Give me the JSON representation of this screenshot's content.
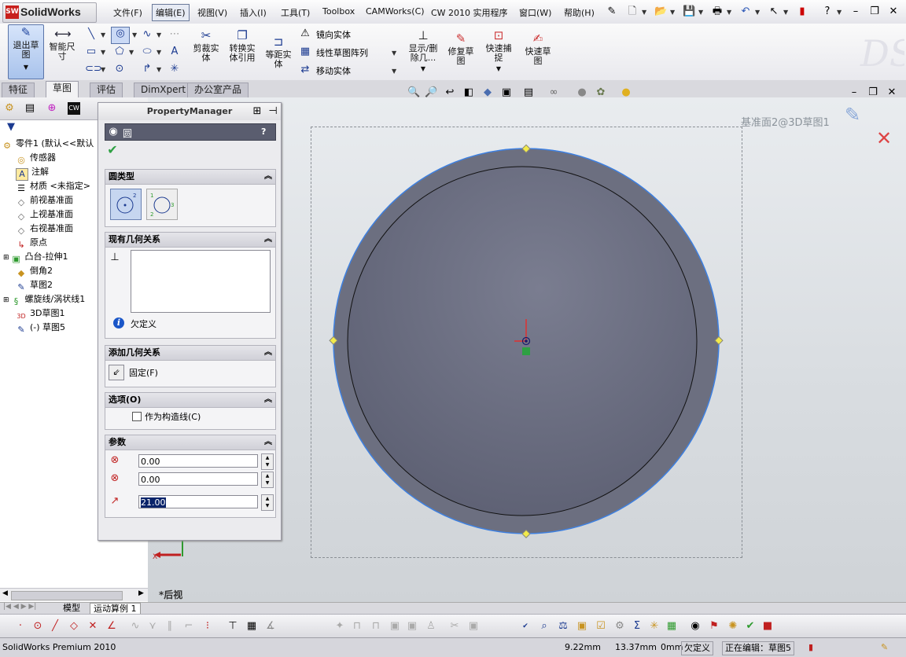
{
  "app": {
    "name": "SolidWorks",
    "logo_badge": "SW"
  },
  "menu": [
    "文件(F)",
    "编辑(E)",
    "视图(V)",
    "插入(I)",
    "工具(T)",
    "Toolbox",
    "CAMWorks(C)",
    "CW 2010 实用程序",
    "窗口(W)",
    "帮助(H)"
  ],
  "menu_active": "编辑(E)",
  "command_manager": {
    "exit_sketch": "退出草\n图",
    "smart_dimension": "智能尺\n寸",
    "trim": "剪裁实\n体",
    "convert": "转换实\n体引用",
    "offset": "等距实\n体",
    "mirror": "镜向实体",
    "linear_pattern": "线性草图阵列",
    "move": "移动实体",
    "show_delete": "显示/删\n除几...",
    "repair": "修复草\n图",
    "quick_snaps": "快速捕\n捉",
    "rapid_sketch": "快速草\n图"
  },
  "tabs": [
    "特征",
    "草图",
    "评估",
    "DimXpert",
    "办公室产品"
  ],
  "active_tab": "草图",
  "tree": [
    {
      "icon": "part-icon",
      "label": "零件1 (默认<<默认"
    },
    {
      "icon": "sensor-icon",
      "label": "传感器"
    },
    {
      "icon": "annotation-icon",
      "label": "注解"
    },
    {
      "icon": "material-icon",
      "label": "材质 <未指定>"
    },
    {
      "icon": "plane-icon",
      "label": "前视基准面"
    },
    {
      "icon": "plane-icon",
      "label": "上视基准面"
    },
    {
      "icon": "plane-icon",
      "label": "右视基准面"
    },
    {
      "icon": "origin-icon",
      "label": "原点"
    },
    {
      "icon": "extrude-icon",
      "label": "凸台-拉伸1"
    },
    {
      "icon": "chamfer-icon",
      "label": "倒角2"
    },
    {
      "icon": "sketch-icon",
      "label": "草图2"
    },
    {
      "icon": "helix-icon",
      "label": "螺旋线/涡状线1"
    },
    {
      "icon": "3dsketch-icon",
      "label": "3D草图1"
    },
    {
      "icon": "sketch-icon",
      "label": "(-) 草图5"
    }
  ],
  "property_manager": {
    "title": "PropertyManager",
    "feature": "圆",
    "help": "?",
    "sections": {
      "circle_type": "圆类型",
      "existing_relations": "现有几何关系",
      "status": "欠定义",
      "add_relations": "添加几何关系",
      "fix": "固定(F)",
      "options": "选项(O)",
      "construction": "作为构造线(C)",
      "parameters": "参数"
    },
    "params": {
      "cx": "0.00",
      "cy": "0.00",
      "radius": "21.00"
    }
  },
  "graphics": {
    "view_label": "基准面2@3D草图1",
    "orientation": "*后视"
  },
  "bottom_tabs": [
    "模型",
    "运动算例 1"
  ],
  "status": {
    "product": "SolidWorks Premium 2010",
    "x": "9.22mm",
    "y": "13.37mm",
    "z": "0mm",
    "state": "欠定义",
    "editing": "正在编辑：草图5"
  }
}
